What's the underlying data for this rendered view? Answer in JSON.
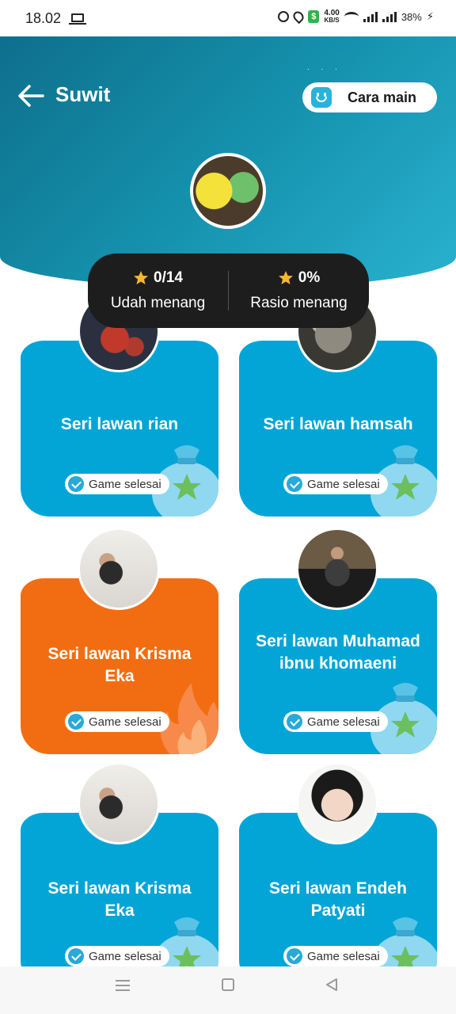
{
  "status_bar": {
    "time": "18.02",
    "speed_value": "4.00",
    "speed_unit": "KB/S",
    "battery": "38%"
  },
  "header": {
    "title": "Suwit",
    "howto_label": "Cara main"
  },
  "stats": {
    "wins_value": "0/14",
    "wins_label": "Udah menang",
    "ratio_value": "0%",
    "ratio_label": "Rasio menang"
  },
  "cards": [
    {
      "title": "Seri lawan rian",
      "badge": "Game selesai",
      "color": "#03a5d6",
      "deco": "money-bag-star-icon"
    },
    {
      "title": "Seri lawan hamsah",
      "badge": "Game selesai",
      "color": "#03a5d6",
      "deco": "money-bag-star-icon"
    },
    {
      "title": "Seri lawan Krisma Eka",
      "badge": "Game selesai",
      "color": "#f26d12",
      "deco": "fire-icon"
    },
    {
      "title": "Seri lawan Muhamad ibnu khomaeni",
      "badge": "Game selesai",
      "color": "#03a5d6",
      "deco": "money-bag-star-icon"
    },
    {
      "title": "Seri lawan Krisma Eka",
      "badge": "Game selesai",
      "color": "#03a5d6",
      "deco": "money-bag-star-icon"
    },
    {
      "title": "Seri lawan Endeh Patyati",
      "badge": "Game selesai",
      "color": "#03a5d6",
      "deco": "money-bag-star-icon"
    }
  ],
  "colors": {
    "accent_blue": "#03a5d6",
    "accent_orange": "#f26d12",
    "star": "#f5b731"
  }
}
